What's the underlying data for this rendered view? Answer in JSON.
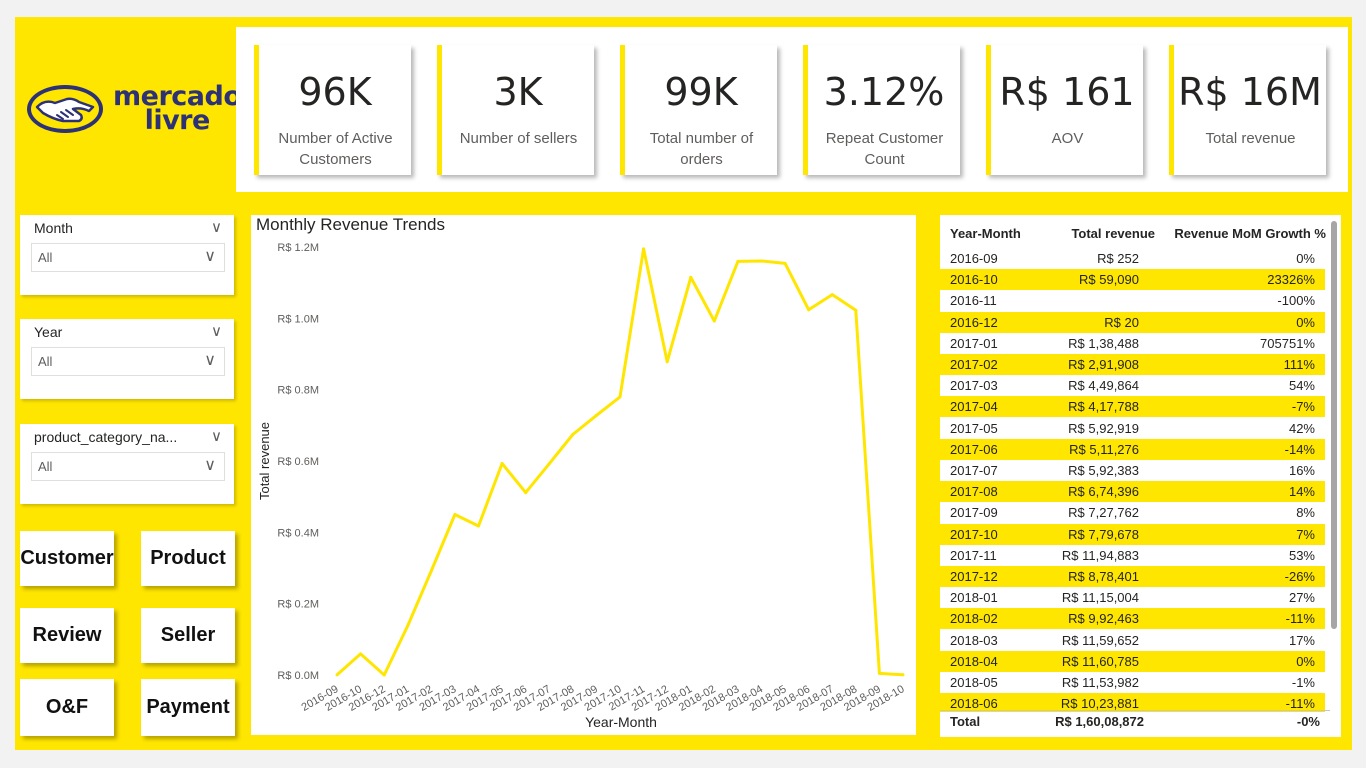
{
  "brand": {
    "line1": "mercado",
    "line2": "livre",
    "primary": "#ffe600",
    "navy": "#2d3277"
  },
  "kpis": [
    {
      "value": "96K",
      "label": "Number of Active Customers"
    },
    {
      "value": "3K",
      "label": "Number of sellers"
    },
    {
      "value": "99K",
      "label": "Total number of orders"
    },
    {
      "value": "3.12%",
      "label": "Repeat Customer Count"
    },
    {
      "value": "R$ 161",
      "label": "AOV"
    },
    {
      "value": "R$ 16M",
      "label": "Total revenue"
    }
  ],
  "slicers": [
    {
      "title": "Month",
      "value": "All"
    },
    {
      "title": "Year",
      "value": "All"
    },
    {
      "title": "product_category_na...",
      "value": "All"
    }
  ],
  "nav": [
    "Customer",
    "Product",
    "Review",
    "Seller",
    "O&F",
    "Payment"
  ],
  "chart_data": {
    "type": "line",
    "title": "Monthly Revenue Trends",
    "xlabel": "Year-Month",
    "ylabel": "Total revenue",
    "ylim": [
      0,
      1200000
    ],
    "yticks": [
      "R$ 0.0M",
      "R$ 0.2M",
      "R$ 0.4M",
      "R$ 0.6M",
      "R$ 0.8M",
      "R$ 1.0M",
      "R$ 1.2M"
    ],
    "color": "#ffe600",
    "x": [
      "2016-09",
      "2016-10",
      "2016-12",
      "2017-01",
      "2017-02",
      "2017-03",
      "2017-04",
      "2017-05",
      "2017-06",
      "2017-07",
      "2017-08",
      "2017-09",
      "2017-10",
      "2017-11",
      "2017-12",
      "2018-01",
      "2018-02",
      "2018-03",
      "2018-04",
      "2018-05",
      "2018-06",
      "2018-07",
      "2018-08",
      "2018-09",
      "2018-10"
    ],
    "values": [
      252,
      59090,
      20,
      138488,
      291908,
      449864,
      417788,
      592919,
      511276,
      592383,
      674396,
      727762,
      779678,
      1194883,
      878401,
      1115004,
      992463,
      1159652,
      1160785,
      1153982,
      1023881,
      1066541,
      1022425,
      4439,
      590
    ]
  },
  "table": {
    "headers": [
      "Year-Month",
      "Total revenue",
      "Revenue MoM Growth %"
    ],
    "rows": [
      [
        "2016-09",
        "R$ 252",
        "0%"
      ],
      [
        "2016-10",
        "R$ 59,090",
        "23326%"
      ],
      [
        "2016-11",
        "",
        "-100%"
      ],
      [
        "2016-12",
        "R$ 20",
        "0%"
      ],
      [
        "2017-01",
        "R$ 1,38,488",
        "705751%"
      ],
      [
        "2017-02",
        "R$ 2,91,908",
        "111%"
      ],
      [
        "2017-03",
        "R$ 4,49,864",
        "54%"
      ],
      [
        "2017-04",
        "R$ 4,17,788",
        "-7%"
      ],
      [
        "2017-05",
        "R$ 5,92,919",
        "42%"
      ],
      [
        "2017-06",
        "R$ 5,11,276",
        "-14%"
      ],
      [
        "2017-07",
        "R$ 5,92,383",
        "16%"
      ],
      [
        "2017-08",
        "R$ 6,74,396",
        "14%"
      ],
      [
        "2017-09",
        "R$ 7,27,762",
        "8%"
      ],
      [
        "2017-10",
        "R$ 7,79,678",
        "7%"
      ],
      [
        "2017-11",
        "R$ 11,94,883",
        "53%"
      ],
      [
        "2017-12",
        "R$ 8,78,401",
        "-26%"
      ],
      [
        "2018-01",
        "R$ 11,15,004",
        "27%"
      ],
      [
        "2018-02",
        "R$ 9,92,463",
        "-11%"
      ],
      [
        "2018-03",
        "R$ 11,59,652",
        "17%"
      ],
      [
        "2018-04",
        "R$ 11,60,785",
        "0%"
      ],
      [
        "2018-05",
        "R$ 11,53,982",
        "-1%"
      ],
      [
        "2018-06",
        "R$ 10,23,881",
        "-11%"
      ]
    ],
    "total": [
      "Total",
      "R$ 1,60,08,872",
      "-0%"
    ]
  }
}
